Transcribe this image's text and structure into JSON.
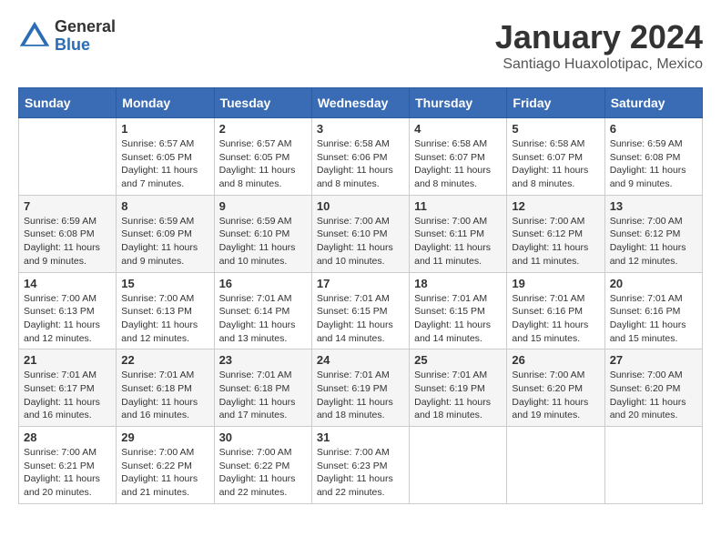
{
  "logo": {
    "general": "General",
    "blue": "Blue"
  },
  "header": {
    "month_year": "January 2024",
    "location": "Santiago Huaxolotipac, Mexico"
  },
  "weekdays": [
    "Sunday",
    "Monday",
    "Tuesday",
    "Wednesday",
    "Thursday",
    "Friday",
    "Saturday"
  ],
  "weeks": [
    [
      {
        "day": "",
        "info": ""
      },
      {
        "day": "1",
        "info": "Sunrise: 6:57 AM\nSunset: 6:05 PM\nDaylight: 11 hours\nand 7 minutes."
      },
      {
        "day": "2",
        "info": "Sunrise: 6:57 AM\nSunset: 6:05 PM\nDaylight: 11 hours\nand 8 minutes."
      },
      {
        "day": "3",
        "info": "Sunrise: 6:58 AM\nSunset: 6:06 PM\nDaylight: 11 hours\nand 8 minutes."
      },
      {
        "day": "4",
        "info": "Sunrise: 6:58 AM\nSunset: 6:07 PM\nDaylight: 11 hours\nand 8 minutes."
      },
      {
        "day": "5",
        "info": "Sunrise: 6:58 AM\nSunset: 6:07 PM\nDaylight: 11 hours\nand 8 minutes."
      },
      {
        "day": "6",
        "info": "Sunrise: 6:59 AM\nSunset: 6:08 PM\nDaylight: 11 hours\nand 9 minutes."
      }
    ],
    [
      {
        "day": "7",
        "info": "Sunrise: 6:59 AM\nSunset: 6:08 PM\nDaylight: 11 hours\nand 9 minutes."
      },
      {
        "day": "8",
        "info": "Sunrise: 6:59 AM\nSunset: 6:09 PM\nDaylight: 11 hours\nand 9 minutes."
      },
      {
        "day": "9",
        "info": "Sunrise: 6:59 AM\nSunset: 6:10 PM\nDaylight: 11 hours\nand 10 minutes."
      },
      {
        "day": "10",
        "info": "Sunrise: 7:00 AM\nSunset: 6:10 PM\nDaylight: 11 hours\nand 10 minutes."
      },
      {
        "day": "11",
        "info": "Sunrise: 7:00 AM\nSunset: 6:11 PM\nDaylight: 11 hours\nand 11 minutes."
      },
      {
        "day": "12",
        "info": "Sunrise: 7:00 AM\nSunset: 6:12 PM\nDaylight: 11 hours\nand 11 minutes."
      },
      {
        "day": "13",
        "info": "Sunrise: 7:00 AM\nSunset: 6:12 PM\nDaylight: 11 hours\nand 12 minutes."
      }
    ],
    [
      {
        "day": "14",
        "info": "Sunrise: 7:00 AM\nSunset: 6:13 PM\nDaylight: 11 hours\nand 12 minutes."
      },
      {
        "day": "15",
        "info": "Sunrise: 7:00 AM\nSunset: 6:13 PM\nDaylight: 11 hours\nand 12 minutes."
      },
      {
        "day": "16",
        "info": "Sunrise: 7:01 AM\nSunset: 6:14 PM\nDaylight: 11 hours\nand 13 minutes."
      },
      {
        "day": "17",
        "info": "Sunrise: 7:01 AM\nSunset: 6:15 PM\nDaylight: 11 hours\nand 14 minutes."
      },
      {
        "day": "18",
        "info": "Sunrise: 7:01 AM\nSunset: 6:15 PM\nDaylight: 11 hours\nand 14 minutes."
      },
      {
        "day": "19",
        "info": "Sunrise: 7:01 AM\nSunset: 6:16 PM\nDaylight: 11 hours\nand 15 minutes."
      },
      {
        "day": "20",
        "info": "Sunrise: 7:01 AM\nSunset: 6:16 PM\nDaylight: 11 hours\nand 15 minutes."
      }
    ],
    [
      {
        "day": "21",
        "info": "Sunrise: 7:01 AM\nSunset: 6:17 PM\nDaylight: 11 hours\nand 16 minutes."
      },
      {
        "day": "22",
        "info": "Sunrise: 7:01 AM\nSunset: 6:18 PM\nDaylight: 11 hours\nand 16 minutes."
      },
      {
        "day": "23",
        "info": "Sunrise: 7:01 AM\nSunset: 6:18 PM\nDaylight: 11 hours\nand 17 minutes."
      },
      {
        "day": "24",
        "info": "Sunrise: 7:01 AM\nSunset: 6:19 PM\nDaylight: 11 hours\nand 18 minutes."
      },
      {
        "day": "25",
        "info": "Sunrise: 7:01 AM\nSunset: 6:19 PM\nDaylight: 11 hours\nand 18 minutes."
      },
      {
        "day": "26",
        "info": "Sunrise: 7:00 AM\nSunset: 6:20 PM\nDaylight: 11 hours\nand 19 minutes."
      },
      {
        "day": "27",
        "info": "Sunrise: 7:00 AM\nSunset: 6:20 PM\nDaylight: 11 hours\nand 20 minutes."
      }
    ],
    [
      {
        "day": "28",
        "info": "Sunrise: 7:00 AM\nSunset: 6:21 PM\nDaylight: 11 hours\nand 20 minutes."
      },
      {
        "day": "29",
        "info": "Sunrise: 7:00 AM\nSunset: 6:22 PM\nDaylight: 11 hours\nand 21 minutes."
      },
      {
        "day": "30",
        "info": "Sunrise: 7:00 AM\nSunset: 6:22 PM\nDaylight: 11 hours\nand 22 minutes."
      },
      {
        "day": "31",
        "info": "Sunrise: 7:00 AM\nSunset: 6:23 PM\nDaylight: 11 hours\nand 22 minutes."
      },
      {
        "day": "",
        "info": ""
      },
      {
        "day": "",
        "info": ""
      },
      {
        "day": "",
        "info": ""
      }
    ]
  ]
}
